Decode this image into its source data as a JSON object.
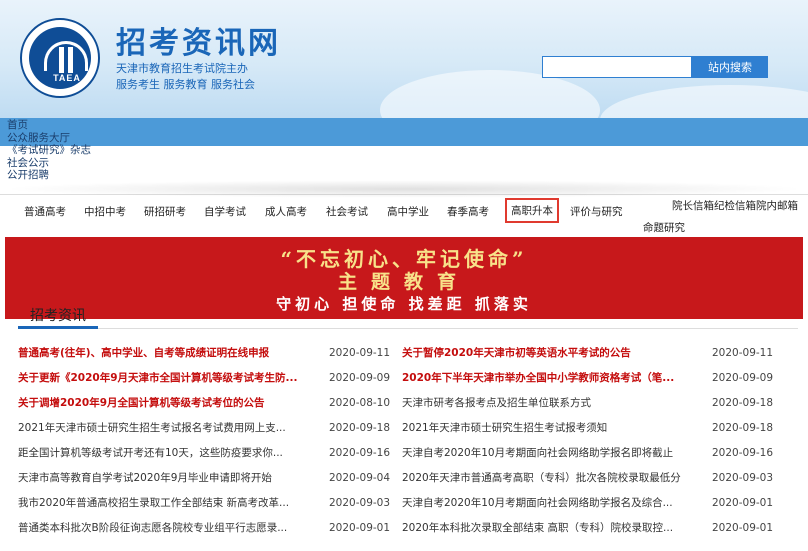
{
  "header": {
    "site_title": "招考资讯网",
    "org": "天津市教育招生考试院主办",
    "slogan": "服务考生 服务教育 服务社会",
    "logo_text": "TAEA",
    "search_placeholder": "",
    "search_button": "站内搜索"
  },
  "top_links": [
    "首页",
    "公众服务大厅",
    "《考试研究》杂志",
    "社会公示",
    "公开招聘"
  ],
  "nav": {
    "items": [
      "普通高考",
      "中招中考",
      "研招研考",
      "自学考试",
      "成人高考",
      "社会考试",
      "高中学业",
      "春季高考",
      "高职升本",
      "评价与研究"
    ],
    "active": "高职升本",
    "right_links": "院长信箱纪检信箱院内邮箱",
    "sub_item": "命题研究"
  },
  "banner": {
    "line1": "“不忘初心、牢记使命”",
    "line2": "主题教育",
    "line3": "守初心 担使命 找差距 抓落实"
  },
  "news_section": {
    "title": "招考资讯",
    "left": [
      {
        "title": "普通高考(往年)、高中学业、自考等成绩证明在线申报",
        "date": "2020-09-11",
        "red": true
      },
      {
        "title": "关于更新《2020年9月天津市全国计算机等级考试考生防...",
        "date": "2020-09-09",
        "red": true
      },
      {
        "title": "关于调增2020年9月全国计算机等级考试考位的公告",
        "date": "2020-08-10",
        "red": true
      },
      {
        "title": "2021年天津市硕士研究生招生考试报名考试费用网上支...",
        "date": "2020-09-18",
        "red": false
      },
      {
        "title": "距全国计算机等级考试开考还有10天，这些防疫要求你...",
        "date": "2020-09-16",
        "red": false
      },
      {
        "title": "天津市高等教育自学考试2020年9月毕业申请即将开始",
        "date": "2020-09-04",
        "red": false
      },
      {
        "title": "我市2020年普通高校招生录取工作全部结束 新高考改革...",
        "date": "2020-09-03",
        "red": false
      },
      {
        "title": "普通类本科批次B阶段征询志愿各院校专业组平行志愿录...",
        "date": "2020-09-01",
        "red": false
      }
    ],
    "right": [
      {
        "title": "关于暂停2020年天津市初等英语水平考试的公告",
        "date": "2020-09-11",
        "red": true
      },
      {
        "title": "2020年下半年天津市举办全国中小学教师资格考试（笔...",
        "date": "2020-09-09",
        "red": true
      },
      {
        "title": "天津市研考各报考点及招生单位联系方式",
        "date": "2020-09-18",
        "red": false
      },
      {
        "title": "2021年天津市硕士研究生招生考试报考须知",
        "date": "2020-09-18",
        "red": false
      },
      {
        "title": "天津自考2020年10月考期面向社会网络助学报名即将截止",
        "date": "2020-09-16",
        "red": false
      },
      {
        "title": "2020年天津市普通高考高职（专科）批次各院校录取最低分",
        "date": "2020-09-03",
        "red": false
      },
      {
        "title": "天津自考2020年10月考期面向社会网络助学报名及综合...",
        "date": "2020-09-01",
        "red": false
      },
      {
        "title": "2020年本科批次录取全部结束 高职（专科）院校录取控...",
        "date": "2020-09-01",
        "red": false
      }
    ]
  },
  "colors": {
    "brand_blue": "#1a66b8",
    "banner_red": "#c7181b",
    "highlight_red": "#c40d0d"
  }
}
